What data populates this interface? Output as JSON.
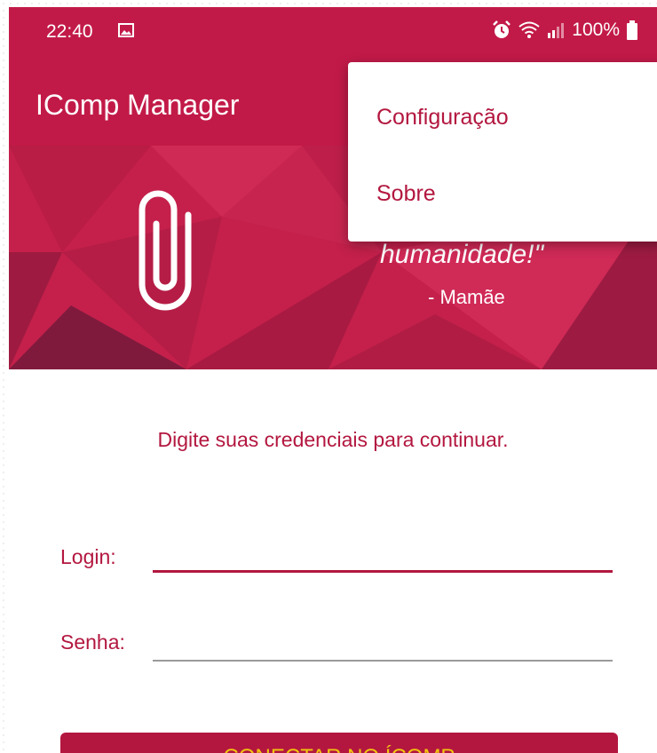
{
  "status": {
    "time": "22:40",
    "battery": "100%",
    "icons": [
      "gallery-icon",
      "alarm-icon",
      "wifi-icon",
      "signal-icon",
      "battery-icon"
    ]
  },
  "app": {
    "title": "IComp Manager"
  },
  "banner": {
    "quote_visible": "humanidade!\"",
    "author": "- Mamãe",
    "icon": "paperclip-icon"
  },
  "menu": {
    "items": [
      {
        "label": "Configuração"
      },
      {
        "label": "Sobre"
      }
    ]
  },
  "form": {
    "prompt": "Digite suas credenciais para continuar.",
    "login_label": "Login:",
    "login_value": "",
    "password_label": "Senha:",
    "password_value": "",
    "submit_label": "CONECTAR NO ÍCOMP"
  },
  "colors": {
    "primary": "#c21a48",
    "text_accent": "#b3173f",
    "button_text": "#f1c40f"
  }
}
